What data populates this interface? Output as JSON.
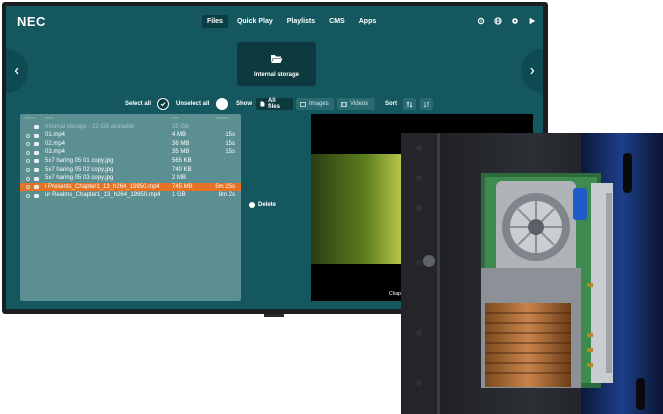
{
  "header": {
    "logo": "NEC",
    "nav": [
      "Files",
      "Quick Play",
      "Playlists",
      "CMS",
      "Apps"
    ],
    "active_nav": "Files",
    "icons": [
      "gear-icon",
      "globe-icon",
      "settings-icon",
      "play-icon"
    ]
  },
  "storage": {
    "label": "Internal storage",
    "icon": "folder-open-icon"
  },
  "controls": {
    "select_all": "Select all",
    "unselect_all": "Unselect all",
    "show": "Show",
    "filters": [
      "All files",
      "Images",
      "Videos"
    ],
    "active_filter": "All files",
    "sort": "Sort"
  },
  "file_list": {
    "headers": [
      "Select",
      "Name",
      "Size",
      "Duration"
    ],
    "rows": [
      {
        "name": "Internal storage - 22 GB available",
        "size": "25 GB",
        "duration": "",
        "type": "storage",
        "selected": false
      },
      {
        "name": "01.mp4",
        "size": "4 MB",
        "duration": "15s",
        "type": "video",
        "selected": false
      },
      {
        "name": "02.mp4",
        "size": "36 MB",
        "duration": "15s",
        "type": "video",
        "selected": false
      },
      {
        "name": "03.mp4",
        "size": "35 MB",
        "duration": "15s",
        "type": "video",
        "selected": false
      },
      {
        "name": "5x7 haring 05 01 copy.jpg",
        "size": "565 KB",
        "duration": "",
        "type": "image",
        "selected": false
      },
      {
        "name": "5x7 haring 05 02 copy.jpg",
        "size": "740 KB",
        "duration": "",
        "type": "image",
        "selected": false
      },
      {
        "name": "5x7 haring 05 03 copy.jpg",
        "size": "2 MB",
        "duration": "",
        "type": "image",
        "selected": false
      },
      {
        "name": "i Presents_Chapter1_13_h264_19950.mp4",
        "size": "745 MB",
        "duration": "5m 25s",
        "type": "video",
        "selected": true
      },
      {
        "name": "ur Realms_Chapter1_13_h264_19950.mp4",
        "size": "1 GB",
        "duration": "8m 2s",
        "type": "video",
        "selected": false
      }
    ]
  },
  "delete_label": "Delete",
  "preview": {
    "caption": "Chapte"
  },
  "colors": {
    "screen_bg": "#14575f",
    "panel_bg": "#5b8f92",
    "selection": "#e67224"
  }
}
